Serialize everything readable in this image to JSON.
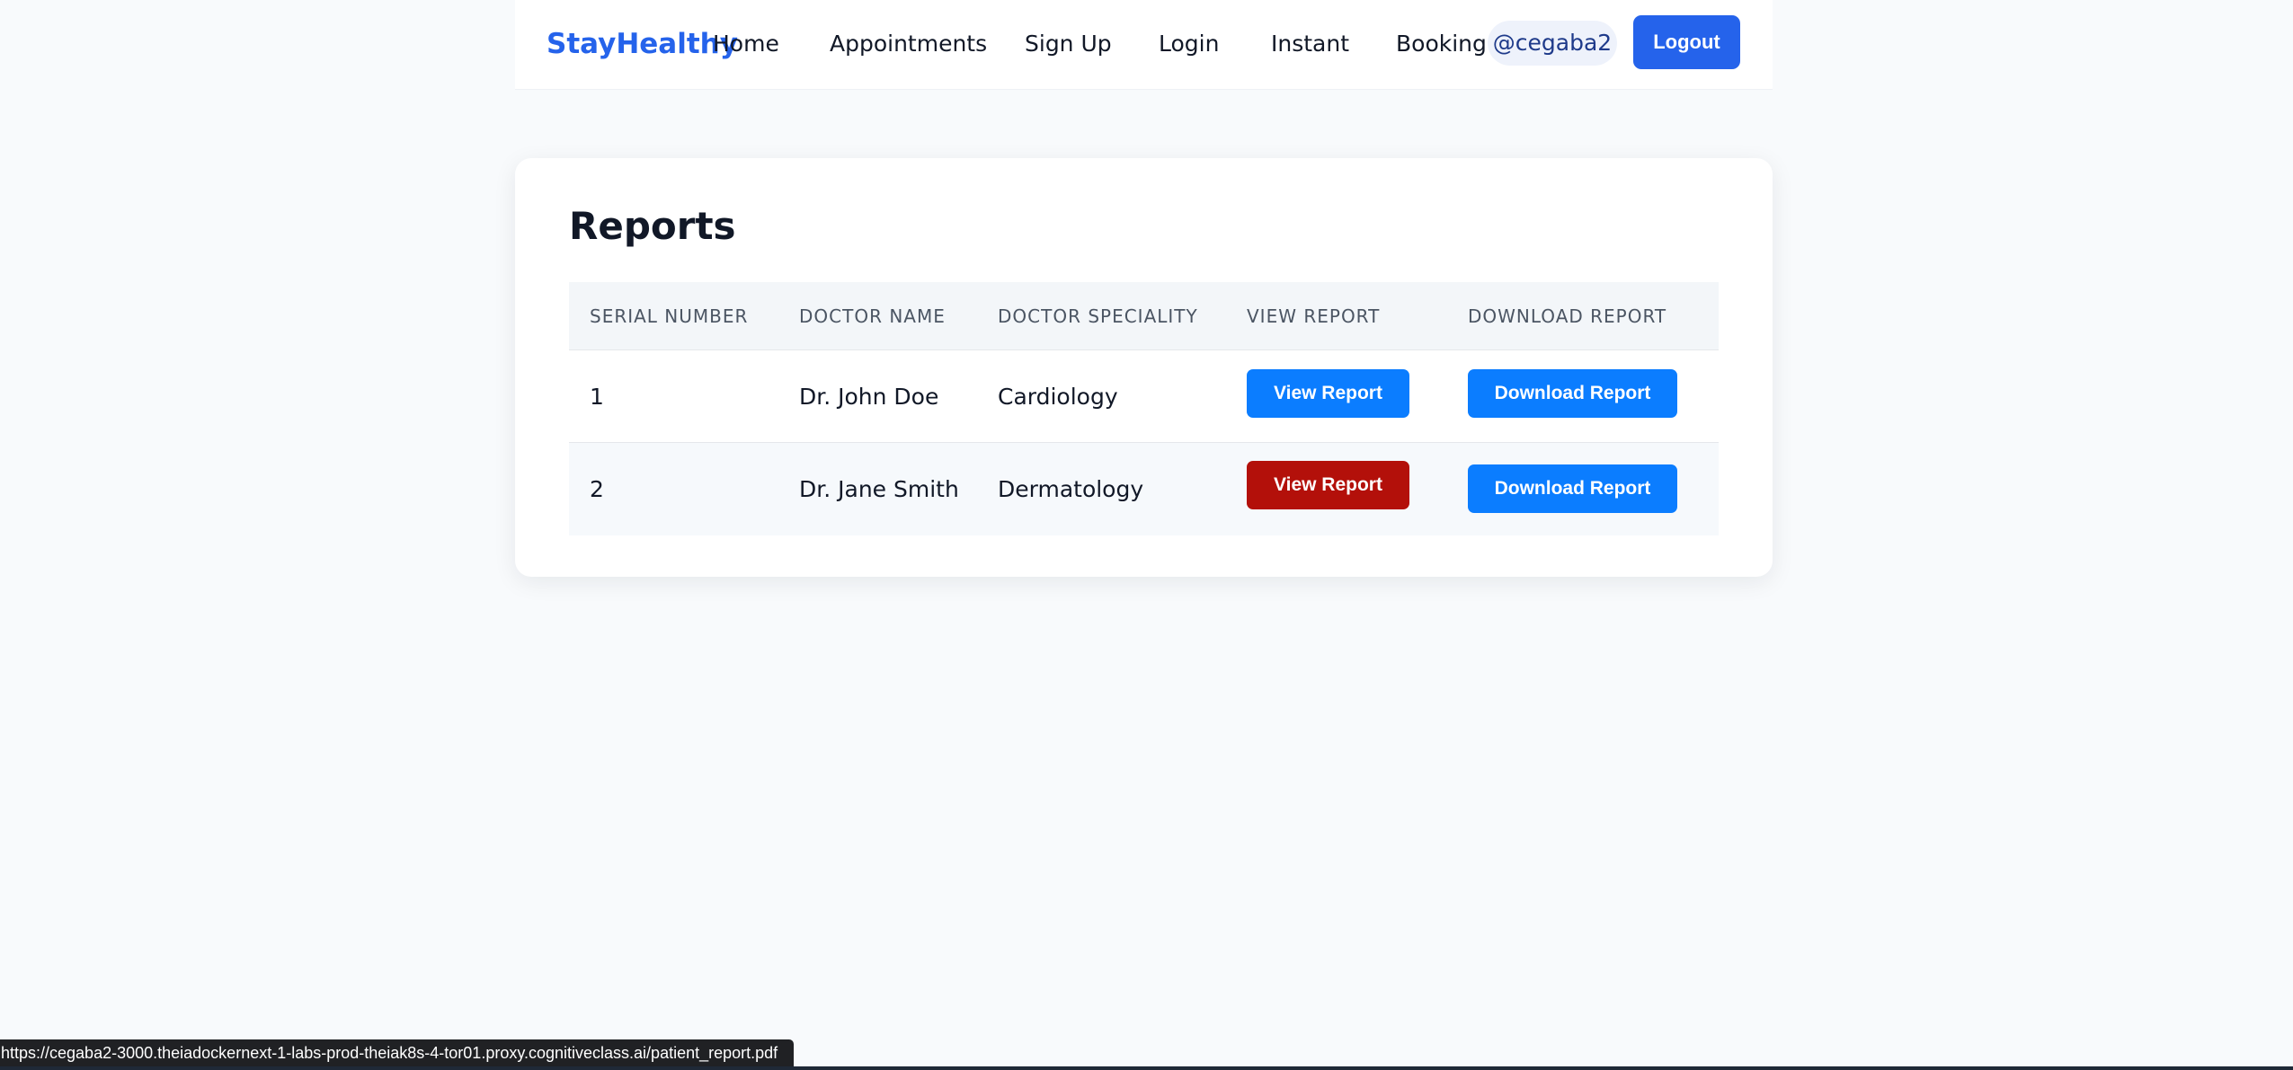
{
  "navbar": {
    "brand": "StayHealthy",
    "links": [
      "Home",
      "Appointments",
      "Sign Up",
      "Login",
      "Instant",
      "Booking"
    ],
    "user": "@cegaba2",
    "logout_label": "Logout"
  },
  "reports": {
    "title": "Reports",
    "columns": [
      "SERIAL NUMBER",
      "DOCTOR NAME",
      "DOCTOR SPECIALITY",
      "VIEW REPORT",
      "DOWNLOAD REPORT"
    ],
    "rows": [
      {
        "serial": "1",
        "doctor": "Dr. John Doe",
        "speciality": "Cardiology",
        "view_label": "View Report",
        "download_label": "Download Report",
        "view_color": "#0b7dff"
      },
      {
        "serial": "2",
        "doctor": "Dr. Jane Smith",
        "speciality": "Dermatology",
        "view_label": "View Report",
        "download_label": "Download Report",
        "view_color": "#b3100a"
      }
    ],
    "download_color": "#0b7dff"
  },
  "status_bar": {
    "url": "https://cegaba2-3000.theiadockernext-1-labs-prod-theiak8s-4-tor01.proxy.cognitiveclass.ai/patient_report.pdf"
  },
  "colors": {
    "accent": "#2563eb",
    "page_bg": "#f8fafc"
  }
}
